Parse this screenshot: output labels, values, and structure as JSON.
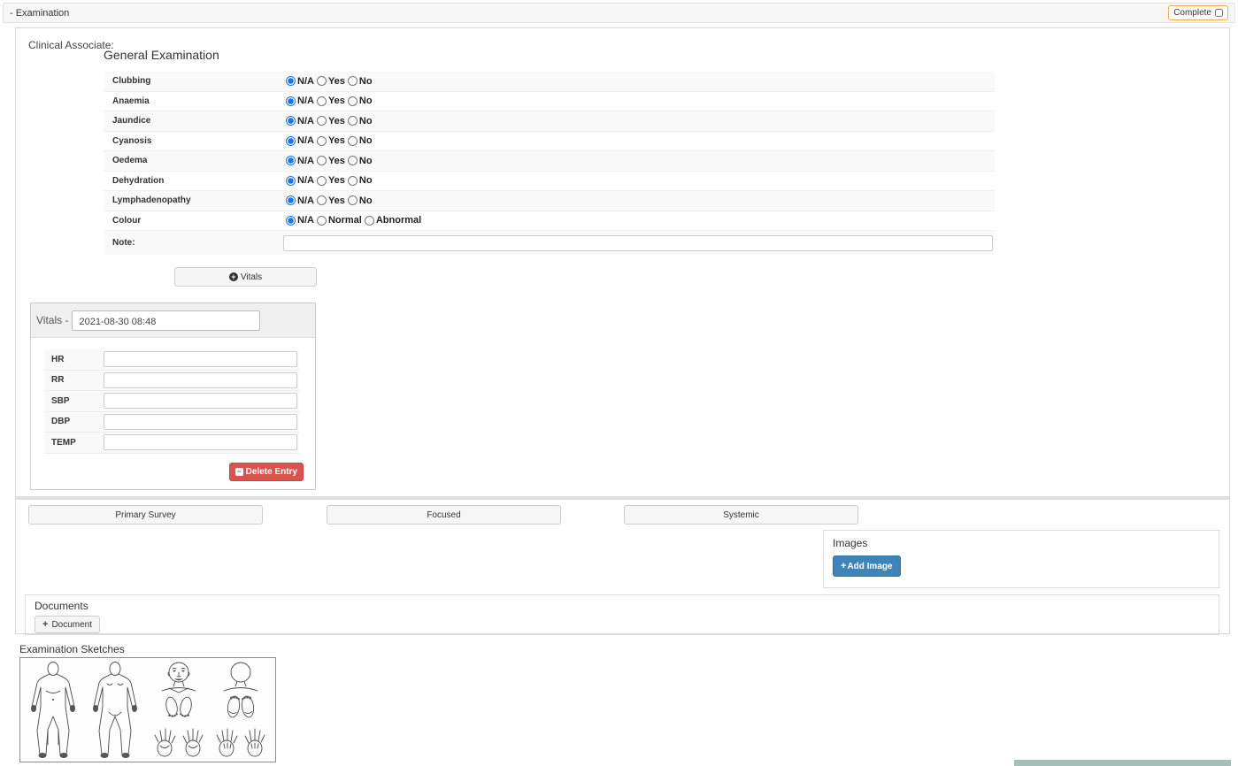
{
  "header": {
    "title": "- Examination",
    "complete_label": "Complete"
  },
  "clinical_associate_label": "Clinical Associate:",
  "general_examination": {
    "title": "General Examination",
    "rows": [
      {
        "label": "Clubbing",
        "options": [
          "N/A",
          "Yes",
          "No"
        ],
        "selected": "N/A"
      },
      {
        "label": "Anaemia",
        "options": [
          "N/A",
          "Yes",
          "No"
        ],
        "selected": "N/A"
      },
      {
        "label": "Jaundice",
        "options": [
          "N/A",
          "Yes",
          "No"
        ],
        "selected": "N/A"
      },
      {
        "label": "Cyanosis",
        "options": [
          "N/A",
          "Yes",
          "No"
        ],
        "selected": "N/A"
      },
      {
        "label": "Oedema",
        "options": [
          "N/A",
          "Yes",
          "No"
        ],
        "selected": "N/A"
      },
      {
        "label": "Dehydration",
        "options": [
          "N/A",
          "Yes",
          "No"
        ],
        "selected": "N/A"
      },
      {
        "label": "Lymphadenopathy",
        "options": [
          "N/A",
          "Yes",
          "No"
        ],
        "selected": "N/A"
      },
      {
        "label": "Colour",
        "options": [
          "N/A",
          "Normal",
          "Abnormal"
        ],
        "selected": "N/A"
      }
    ],
    "note": {
      "label": "Note:",
      "value": ""
    }
  },
  "vitals_add_button": {
    "label": "Vitals",
    "icon": "plus-circle-icon"
  },
  "vitals_panel": {
    "title": "Vitals -",
    "datetime_value": "2021-08-30 08:48",
    "fields": [
      {
        "label": "HR",
        "value": ""
      },
      {
        "label": "RR",
        "value": ""
      },
      {
        "label": "SBP",
        "value": ""
      },
      {
        "label": "DBP",
        "value": ""
      },
      {
        "label": "TEMP",
        "value": ""
      }
    ],
    "delete_button": {
      "label": "Delete Entry",
      "icon": "minus-square-icon"
    }
  },
  "survey_buttons": [
    "Primary Survey",
    "Focused",
    "Systemic"
  ],
  "images_section": {
    "title": "Images",
    "add_button_label": "Add Image",
    "add_button_icon": "plus-icon"
  },
  "documents_section": {
    "title": "Documents",
    "add_button_label": "Document",
    "add_button_icon": "plus-icon"
  },
  "sketches_section": {
    "title": "Examination Sketches",
    "figures": [
      "body-front",
      "body-back",
      "face-feet-hands-front",
      "head-back-soles-hands-back"
    ]
  },
  "colors": {
    "complete_border_orange": "#f0ad4e",
    "danger_red": "#d9534f",
    "add_image_blue": "#3d84b8",
    "radio_accent_blue": "#1a73e8",
    "row_stripe_gray": "#f9f9f9",
    "teal_bar": "#a4c0b9"
  }
}
